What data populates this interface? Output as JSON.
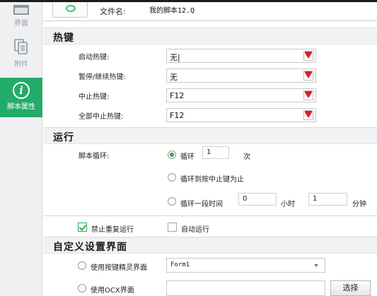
{
  "sidebar": {
    "items": [
      {
        "label": "界面"
      },
      {
        "label": "附件"
      },
      {
        "label": "脚本属性",
        "icon_glyph": "i"
      }
    ]
  },
  "file": {
    "label": "文件名:",
    "value": "我的脚本12.Q"
  },
  "hotkeys": {
    "title": "热键",
    "rows": [
      {
        "label": "启动热键:",
        "value": "无|"
      },
      {
        "label": "暂停/继续热键:",
        "value": "无"
      },
      {
        "label": "中止热键:",
        "value": "F12"
      },
      {
        "label": "全部中止热键:",
        "value": "F12"
      }
    ]
  },
  "run": {
    "title": "运行",
    "loop_label": "脚本循环:",
    "options": {
      "loop": {
        "label": "循环",
        "count": "1",
        "unit": "次",
        "selected": true
      },
      "until_stop": {
        "label": "循环到按中止键为止",
        "selected": false
      },
      "duration": {
        "label": "循环一段时间",
        "hours": "0",
        "hours_unit": "小时",
        "minutes": "1",
        "minutes_unit": "分钟",
        "selected": false
      }
    }
  },
  "checks": {
    "no_repeat": {
      "label": "禁止重复运行",
      "checked": true
    },
    "auto_run": {
      "label": "自动运行",
      "checked": false
    }
  },
  "custom_ui": {
    "title": "自定义设置界面",
    "sprite_label": "使用按键精灵界面",
    "sprite_value": "Form1",
    "ocx_label": "使用OCX界面",
    "choose_label": "选择"
  },
  "colors": {
    "accent": "#23ab6a",
    "dropdown_arrow": "#d8202a"
  }
}
